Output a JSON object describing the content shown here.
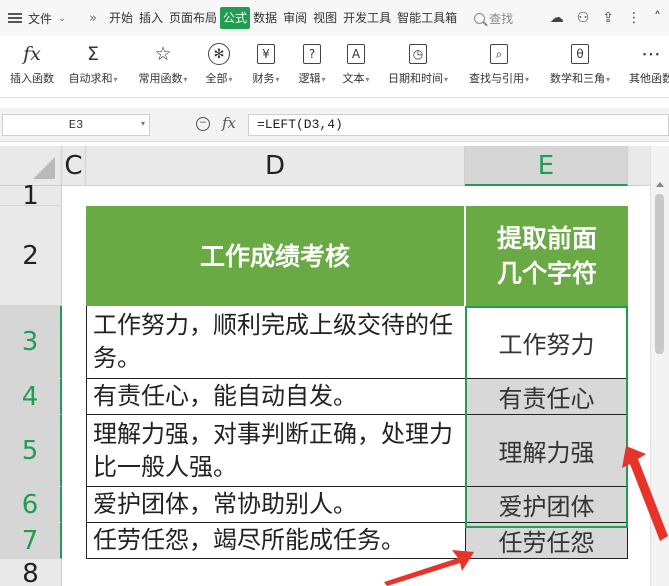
{
  "menubar": {
    "file_label": "文件",
    "expand_icon": "»",
    "tabs": [
      "开始",
      "插入",
      "页面布局",
      "公式",
      "数据",
      "审阅",
      "视图",
      "开发工具",
      "智能工具箱"
    ],
    "active_tab": "公式",
    "search_label": "查找",
    "accent_color": "#1f9e50"
  },
  "ribbon": {
    "items": [
      {
        "label": "插入函数",
        "icon": "fx"
      },
      {
        "label": "自动求和",
        "icon": "Σ"
      },
      {
        "label": "常用函数",
        "icon": "☆"
      },
      {
        "label": "全部",
        "icon": "✻"
      },
      {
        "label": "财务",
        "icon": "¥"
      },
      {
        "label": "逻辑",
        "icon": "?"
      },
      {
        "label": "文本",
        "icon": "A"
      },
      {
        "label": "日期和时间",
        "icon": "◷"
      },
      {
        "label": "查找与引用",
        "icon": "⌕"
      },
      {
        "label": "数学和三角",
        "icon": "θ"
      },
      {
        "label": "其他函数",
        "icon": "⋯"
      }
    ]
  },
  "formula_bar": {
    "name_box": "E3",
    "fx_label": "fx",
    "formula": "=LEFT(D3,4)"
  },
  "grid": {
    "columns": [
      "C",
      "D",
      "E"
    ],
    "selected_column": "E",
    "rows": [
      "1",
      "2",
      "3",
      "4",
      "5",
      "6",
      "7",
      "8"
    ],
    "header_d": "工作成绩考核",
    "header_e_line1": "提取前面",
    "header_e_line2": "几个字符",
    "d_values": [
      "工作努力，顺利完成上级交待的任务。",
      "有责任心，能自动自发。",
      "理解力强，对事判断正确，处理力比一般人强。",
      "爱护团体，常协助别人。",
      "任劳任怨，竭尽所能成任务。"
    ],
    "e_values": [
      "工作努力",
      "有责任心",
      "理解力强",
      "爱护团体",
      "任劳任怨"
    ],
    "header_bg": "#6aaa45"
  },
  "annotation": {
    "arrow_color": "#e8332a"
  }
}
